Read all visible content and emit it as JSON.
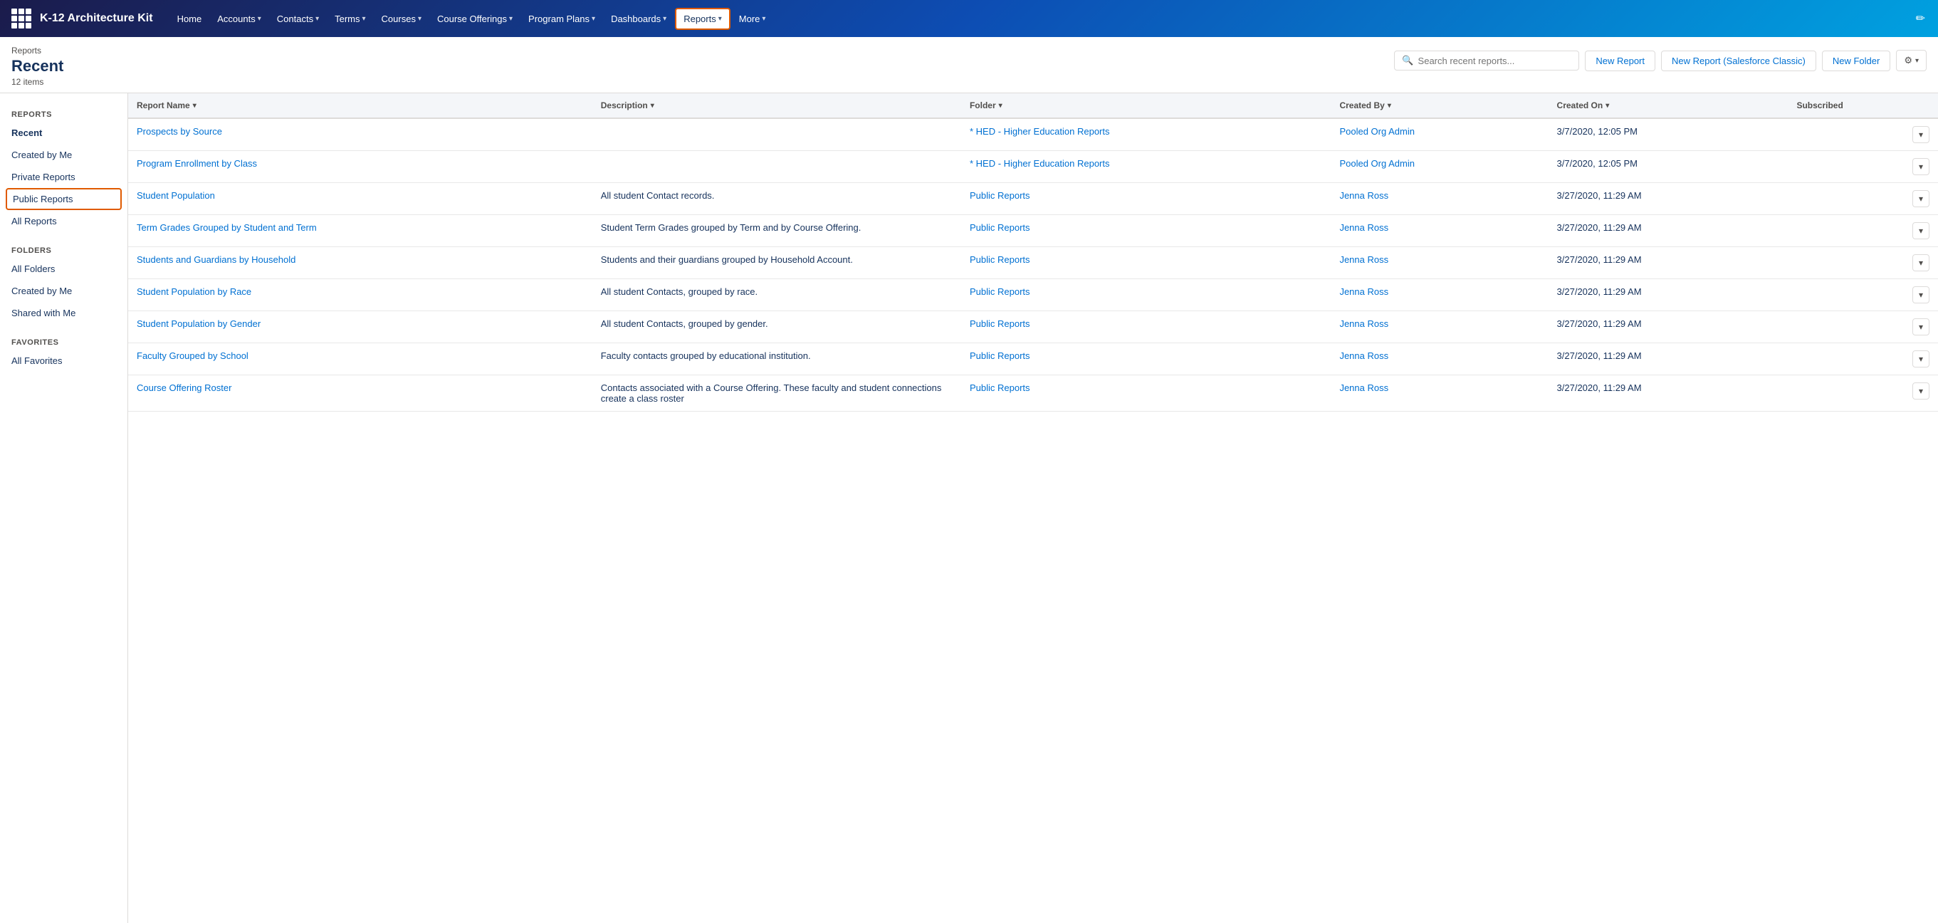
{
  "app": {
    "name": "K-12 Architecture Kit",
    "icon": "grid-icon"
  },
  "nav": {
    "items": [
      {
        "label": "Home",
        "hasDropdown": false,
        "active": false
      },
      {
        "label": "Accounts",
        "hasDropdown": true,
        "active": false
      },
      {
        "label": "Contacts",
        "hasDropdown": true,
        "active": false
      },
      {
        "label": "Terms",
        "hasDropdown": true,
        "active": false
      },
      {
        "label": "Courses",
        "hasDropdown": true,
        "active": false
      },
      {
        "label": "Course Offerings",
        "hasDropdown": true,
        "active": false
      },
      {
        "label": "Program Plans",
        "hasDropdown": true,
        "active": false
      },
      {
        "label": "Dashboards",
        "hasDropdown": true,
        "active": false
      },
      {
        "label": "Reports",
        "hasDropdown": true,
        "active": true
      },
      {
        "label": "More",
        "hasDropdown": true,
        "active": false
      }
    ]
  },
  "page": {
    "breadcrumb": "Reports",
    "title": "Recent",
    "item_count": "12 items"
  },
  "search": {
    "placeholder": "Search recent reports..."
  },
  "buttons": {
    "new_report": "New Report",
    "new_report_classic": "New Report (Salesforce Classic)",
    "new_folder": "New Folder"
  },
  "sidebar": {
    "reports_label": "REPORTS",
    "reports_items": [
      {
        "label": "Recent",
        "active": true
      },
      {
        "label": "Created by Me",
        "active": false
      },
      {
        "label": "Private Reports",
        "active": false
      },
      {
        "label": "Public Reports",
        "active": false,
        "highlighted": true
      },
      {
        "label": "All Reports",
        "active": false
      }
    ],
    "folders_label": "FOLDERS",
    "folders_items": [
      {
        "label": "All Folders",
        "active": false
      },
      {
        "label": "Created by Me",
        "active": false
      },
      {
        "label": "Shared with Me",
        "active": false
      }
    ],
    "favorites_label": "FAVORITES",
    "favorites_items": [
      {
        "label": "All Favorites",
        "active": false
      }
    ]
  },
  "table": {
    "columns": [
      {
        "label": "Report Name",
        "sortable": true
      },
      {
        "label": "Description",
        "sortable": true
      },
      {
        "label": "Folder",
        "sortable": true
      },
      {
        "label": "Created By",
        "sortable": true
      },
      {
        "label": "Created On",
        "sortable": true
      },
      {
        "label": "Subscribed",
        "sortable": false
      }
    ],
    "rows": [
      {
        "name": "Prospects by Source",
        "description": "",
        "folder": "* HED - Higher Education Reports",
        "created_by": "Pooled Org Admin",
        "created_on": "3/7/2020, 12:05 PM"
      },
      {
        "name": "Program Enrollment by Class",
        "description": "",
        "folder": "* HED - Higher Education Reports",
        "created_by": "Pooled Org Admin",
        "created_on": "3/7/2020, 12:05 PM"
      },
      {
        "name": "Student Population",
        "description": "All student Contact records.",
        "folder": "Public Reports",
        "created_by": "Jenna Ross",
        "created_on": "3/27/2020, 11:29 AM"
      },
      {
        "name": "Term Grades Grouped by Student and Term",
        "description": "Student Term Grades grouped by Term and by Course Offering.",
        "folder": "Public Reports",
        "created_by": "Jenna Ross",
        "created_on": "3/27/2020, 11:29 AM"
      },
      {
        "name": "Students and Guardians by Household",
        "description": "Students and their guardians grouped by Household Account.",
        "folder": "Public Reports",
        "created_by": "Jenna Ross",
        "created_on": "3/27/2020, 11:29 AM"
      },
      {
        "name": "Student Population by Race",
        "description": "All student Contacts, grouped by race.",
        "folder": "Public Reports",
        "created_by": "Jenna Ross",
        "created_on": "3/27/2020, 11:29 AM"
      },
      {
        "name": "Student Population by Gender",
        "description": "All student Contacts, grouped by gender.",
        "folder": "Public Reports",
        "created_by": "Jenna Ross",
        "created_on": "3/27/2020, 11:29 AM"
      },
      {
        "name": "Faculty Grouped by School",
        "description": "Faculty contacts grouped by educational institution.",
        "folder": "Public Reports",
        "created_by": "Jenna Ross",
        "created_on": "3/27/2020, 11:29 AM"
      },
      {
        "name": "Course Offering Roster",
        "description": "Contacts associated with a Course Offering. These faculty and student connections create a class roster",
        "folder": "Public Reports",
        "created_by": "Jenna Ross",
        "created_on": "3/27/2020, 11:29 AM"
      }
    ]
  }
}
